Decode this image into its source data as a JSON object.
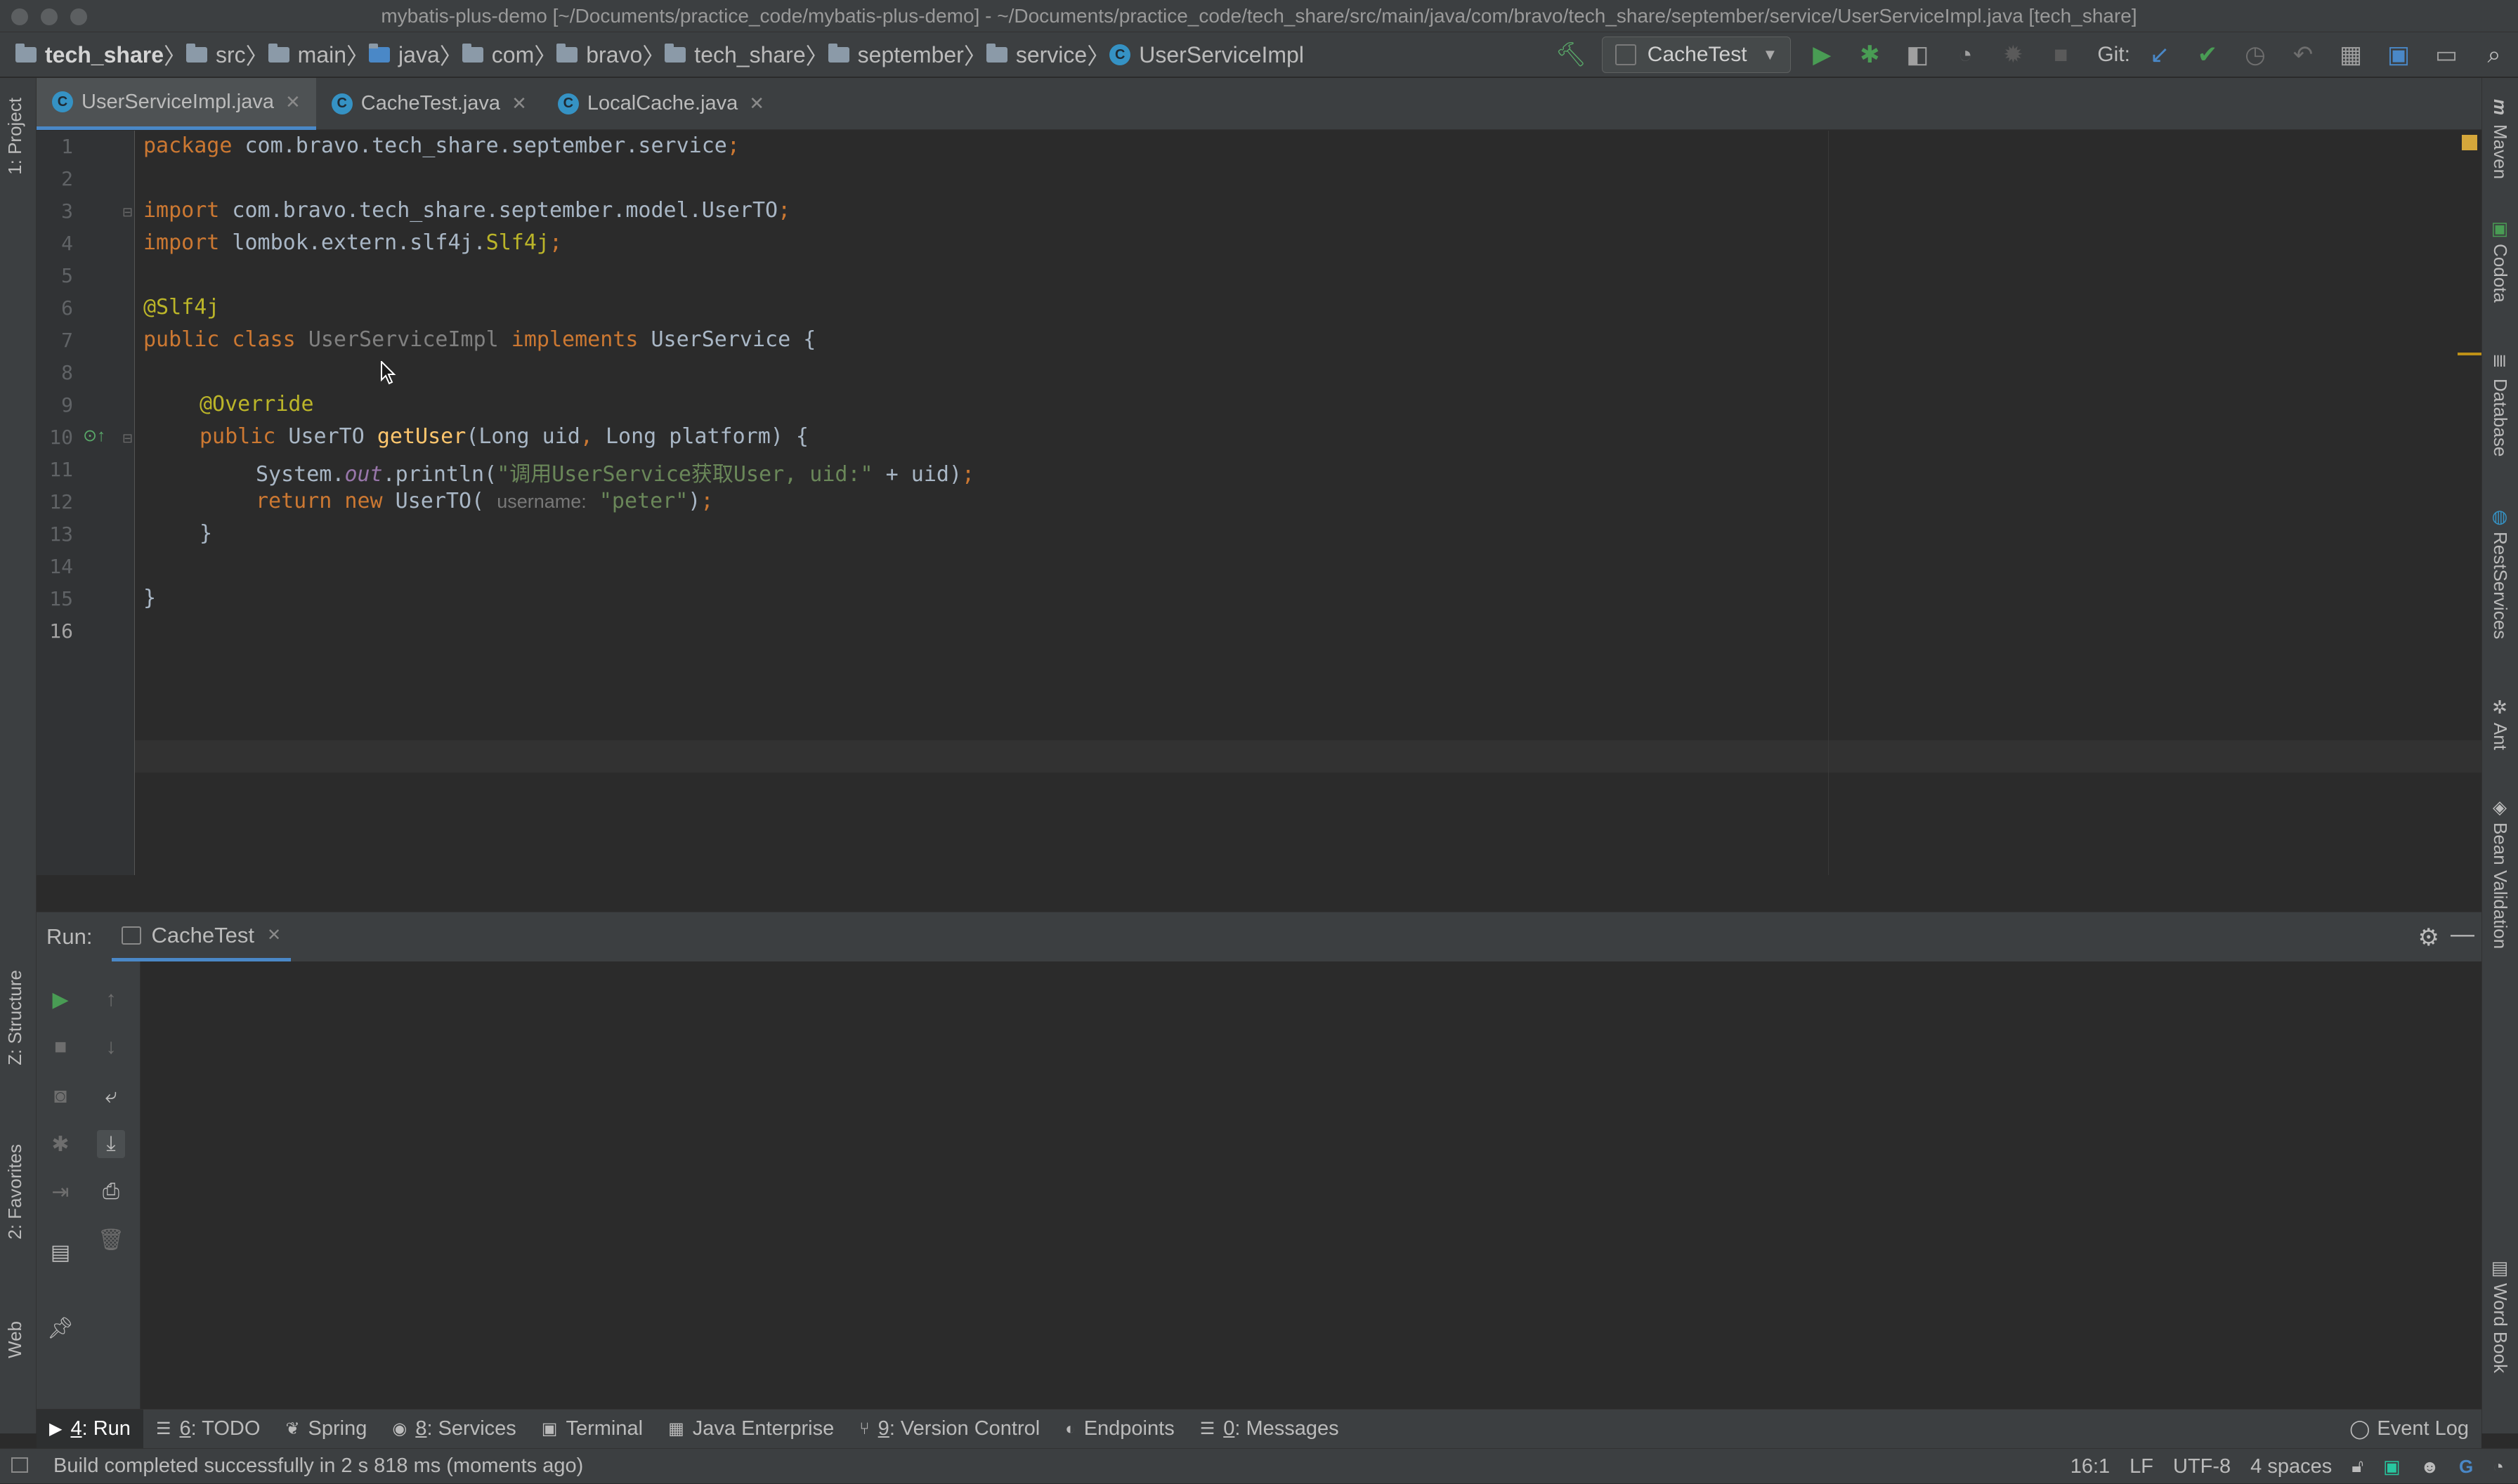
{
  "window": {
    "title": "mybatis-plus-demo [~/Documents/practice_code/mybatis-plus-demo] - ~/Documents/practice_code/tech_share/src/main/java/com/bravo/tech_share/september/service/UserServiceImpl.java [tech_share]"
  },
  "breadcrumb": [
    "tech_share",
    "src",
    "main",
    "java",
    "com",
    "bravo",
    "tech_share",
    "september",
    "service",
    "UserServiceImpl"
  ],
  "toolbar": {
    "run_config": "CacheTest",
    "git_label": "Git:"
  },
  "tabs": [
    {
      "label": "UserServiceImpl.java",
      "active": true
    },
    {
      "label": "CacheTest.java",
      "active": false
    },
    {
      "label": "LocalCache.java",
      "active": false
    }
  ],
  "left_tools": {
    "project": "1: Project",
    "structure": "Z: Structure",
    "favorites": "2: Favorites",
    "web": "Web"
  },
  "right_tools": {
    "maven": "Maven",
    "codota": "Codota",
    "database": "Database",
    "restservices": "RestServices",
    "ant": "Ant",
    "bean_validation": "Bean Validation",
    "word_book": "Word Book"
  },
  "editor": {
    "line_numbers": [
      "1",
      "2",
      "3",
      "4",
      "5",
      "6",
      "7",
      "8",
      "9",
      "10",
      "11",
      "12",
      "13",
      "14",
      "15",
      "16"
    ],
    "code": {
      "l1_kw": "package",
      "l1_rest": " com.bravo.tech_share.september.service",
      "l1_semi": ";",
      "l3_kw": "import",
      "l3_rest": " com.bravo.tech_share.september.model.UserTO",
      "l3_semi": ";",
      "l4_kw": "import",
      "l4_pkg": " lombok.extern.slf4j.",
      "l4_cls": "Slf4j",
      "l4_semi": ";",
      "l6_ann": "@Slf4j",
      "l7_kw1": "public class ",
      "l7_cls": "UserServiceImpl",
      "l7_kw2": " implements ",
      "l7_iface": "UserService {",
      "l9_ann": "@Override",
      "l10_kw": "public",
      "l10_type": " UserTO ",
      "l10_fn": "getUser",
      "l10_p1": "(Long uid",
      "l10_comma": ",",
      "l10_p2": " Long platform) {",
      "l11_a": "System.",
      "l11_out": "out",
      "l11_b": ".println(",
      "l11_str": "\"调用UserService获取User, uid:\"",
      "l11_c": " + uid)",
      "l11_semi": ";",
      "l12_kw1": "return",
      "l12_kw2": " new",
      "l12_a": " UserTO( ",
      "l12_hint": "username:",
      "l12_str": " \"peter\"",
      "l12_b": ")",
      "l12_semi": ";",
      "l13": "}",
      "l15": "}"
    }
  },
  "run_panel": {
    "label": "Run:",
    "tab": "CacheTest"
  },
  "bottom_tabs": [
    {
      "key": "4",
      "label": ": Run",
      "icon": "run-icon"
    },
    {
      "key": "6",
      "label": ": TODO",
      "icon": "todo-icon"
    },
    {
      "key": "",
      "label": "Spring",
      "icon": "spring-icon"
    },
    {
      "key": "8",
      "label": ": Services",
      "icon": "services-icon"
    },
    {
      "key": "",
      "label": "Terminal",
      "icon": "terminal-icon"
    },
    {
      "key": "",
      "label": "Java Enterprise",
      "icon": "java-enterprise-icon"
    },
    {
      "key": "9",
      "label": ": Version Control",
      "icon": "version-control-icon"
    },
    {
      "key": "",
      "label": "Endpoints",
      "icon": "endpoints-icon"
    },
    {
      "key": "0",
      "label": ": Messages",
      "icon": "messages-icon"
    }
  ],
  "event_log": "Event Log",
  "status": {
    "message": "Build completed successfully in 2 s 818 ms (moments ago)",
    "position": "16:1",
    "line_sep": "LF",
    "encoding": "UTF-8",
    "indent": "4 spaces"
  }
}
